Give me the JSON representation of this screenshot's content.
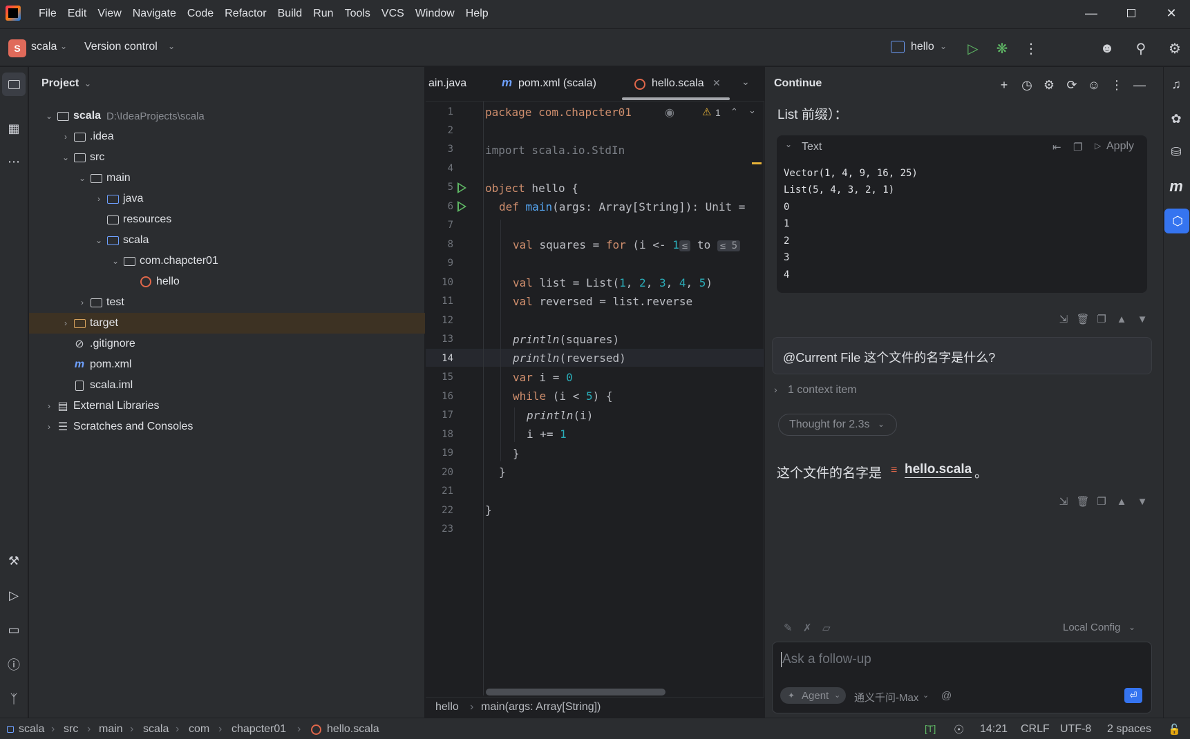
{
  "menu": [
    "File",
    "Edit",
    "View",
    "Navigate",
    "Code",
    "Refactor",
    "Build",
    "Run",
    "Tools",
    "VCS",
    "Window",
    "Help"
  ],
  "toolbar": {
    "project_badge": "S",
    "project_name": "scala",
    "vcs_label": "Version control",
    "run_config": "hello"
  },
  "project": {
    "header": "Project",
    "root_name": "scala",
    "root_path": "D:\\IdeaProjects\\scala",
    "items": [
      {
        "label": ".idea"
      },
      {
        "label": "src"
      },
      {
        "label": "main"
      },
      {
        "label": "java"
      },
      {
        "label": "resources"
      },
      {
        "label": "scala"
      },
      {
        "label": "com.chapcter01"
      },
      {
        "label": "hello"
      },
      {
        "label": "test"
      },
      {
        "label": "target"
      },
      {
        "label": ".gitignore"
      },
      {
        "label": "pom.xml"
      },
      {
        "label": "scala.iml"
      },
      {
        "label": "External Libraries"
      },
      {
        "label": "Scratches and Consoles"
      }
    ]
  },
  "editor": {
    "tabs": [
      {
        "label": "ain.java"
      },
      {
        "label": "pom.xml (scala)"
      },
      {
        "label": "hello.scala"
      }
    ],
    "warning_count": "1",
    "line_numbers": [
      "1",
      "2",
      "3",
      "4",
      "5",
      "6",
      "7",
      "8",
      "9",
      "10",
      "11",
      "12",
      "13",
      "14",
      "15",
      "16",
      "17",
      "18",
      "19",
      "20",
      "21",
      "22",
      "23"
    ],
    "code": {
      "l1": "package com.chapcter01",
      "l3": "import scala.io.StdIn",
      "l5a": "object",
      "l5b": " hello {",
      "l6a": "def",
      "l6b": "main",
      "l6c": "(args: Array[String]): Unit = ",
      "l8a": "val",
      "l8b": " squares = ",
      "l8c": "for",
      "l8d": " (i <- ",
      "l8e": "1",
      "l8f": "≤",
      "l8g": " to ",
      "l8h": "≤ 5",
      "l10a": "val",
      "l10b": " list = List(",
      "l10c": "1",
      "l10d": "2",
      "l10e": "3",
      "l10f": "4",
      "l10g": "5",
      "l11a": "val",
      "l11b": " reversed = list.reverse",
      "l13": "println",
      "l13b": "(squares)",
      "l14": "println",
      "l14b": "(reversed)",
      "l15a": "var",
      "l15b": " i = ",
      "l15c": "0",
      "l16a": "while",
      "l16b": " (i < ",
      "l16c": "5",
      "l16d": ") {",
      "l17": "println",
      "l17b": "(i)",
      "l18a": "i += ",
      "l18b": "1",
      "l19": "}",
      "l20": "}",
      "l22": "}"
    },
    "breadcrumb": [
      "hello",
      "main(args: Array[String])"
    ]
  },
  "continue": {
    "title": "Continue",
    "prev_text": "List 前缀）：",
    "code_block_lang": "Text",
    "apply_label": "Apply",
    "output_lines": [
      "Vector(1, 4, 9, 16, 25)",
      "List(5, 4, 3, 2, 1)",
      "0",
      "1",
      "2",
      "3",
      "4"
    ],
    "user_message": "@Current File 这个文件的名字是什么?",
    "context_items": "1 context item",
    "thought": "Thought for 2.3s",
    "answer_prefix": "这个文件的名字是",
    "answer_file": "hello.scala",
    "answer_suffix": "。",
    "local_config": "Local Config",
    "input_placeholder": "Ask a follow-up",
    "agent_label": "Agent",
    "model_label": "通义千问-Max",
    "at_symbol": "@"
  },
  "statusbar": {
    "path": [
      "scala",
      "src",
      "main",
      "scala",
      "com",
      "chapcter01",
      "hello.scala"
    ],
    "typing_mode": "[T]",
    "position": "14:21",
    "line_sep": "CRLF",
    "encoding": "UTF-8",
    "indent": "2 spaces"
  },
  "colors": {
    "accent": "#3574f0",
    "background": "#1e1f22",
    "panel": "#2b2d30",
    "keyword": "#cf8e6d",
    "function": "#56a8f5",
    "number": "#2aacb8"
  }
}
